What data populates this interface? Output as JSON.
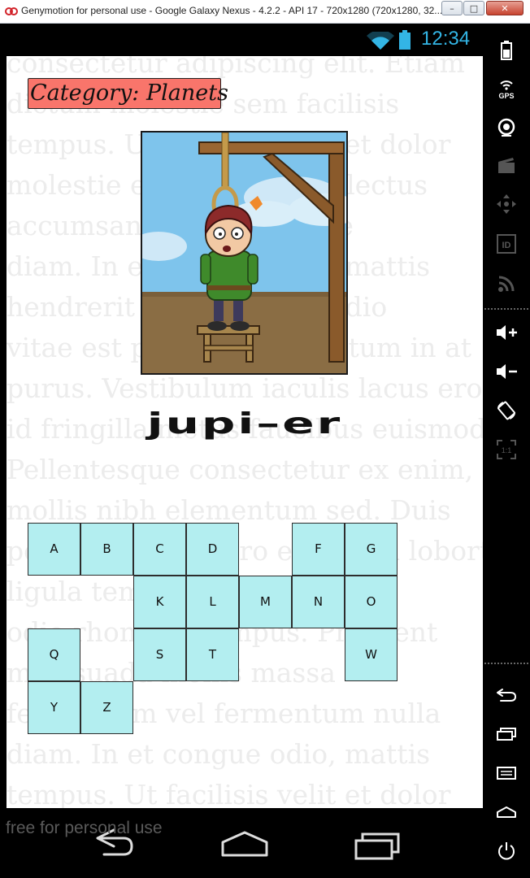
{
  "window": {
    "title": "Genymotion for personal use - Google Galaxy Nexus - 4.2.2 - API 17 - 720x1280 (720x1280, 32...",
    "minimize_label": "–",
    "maximize_label": "□",
    "close_label": "✕"
  },
  "statusbar": {
    "time": "12:34",
    "wifi_icon": "wifi-icon",
    "battery_icon": "battery-icon",
    "accent_color": "#33b5e5"
  },
  "game": {
    "category": "Category: Planets",
    "word": "jupi–er",
    "category_color": "#f9756b",
    "key_color": "#b3eef0",
    "keys": [
      {
        "letter": "A"
      },
      {
        "letter": "B"
      },
      {
        "letter": "C"
      },
      {
        "letter": "D"
      },
      {
        "letter": "F"
      },
      {
        "letter": "G"
      },
      {
        "letter": "K"
      },
      {
        "letter": "L"
      },
      {
        "letter": "M"
      },
      {
        "letter": "N"
      },
      {
        "letter": "O"
      },
      {
        "letter": "Q"
      },
      {
        "letter": "S"
      },
      {
        "letter": "T"
      },
      {
        "letter": "W"
      },
      {
        "letter": "Y"
      },
      {
        "letter": "Z"
      }
    ],
    "background_text": [
      "consectetur adipiscing elit. Etiam",
      "dictum molestie sem facilisis",
      "tempus. Ut facilisis velit et dolor",
      "molestie elementum sed lectus",
      "accumsan, ac scelerisque",
      "diam. In et congue odio, mattis",
      "hendrerit vulputate vel odio",
      "vitae est placerat fermentum in at",
      "purus. Vestibulum iaculis lacus eros,",
      "id fringilla metus faucibus euismod.",
      "Pellentesque consectetur ex enim, et",
      "mollis nibh elementum sed. Duis",
      "pellentesque libero erat, non lobortis",
      "ligula tempus ut. Duis vitae",
      "odio rhoncus, tempus. Praesent",
      "malesuada mollis massa",
      "fermentum vel fermentum nulla",
      "diam. In et congue odio, mattis",
      "tempus. Ut facilisis velit et dolor"
    ]
  },
  "navbar": {
    "back_icon": "back-icon",
    "home_icon": "home-icon",
    "recents_icon": "recent-apps-icon",
    "watermark": "free for personal use"
  },
  "sidebar": {
    "items": [
      {
        "icon": "battery-icon"
      },
      {
        "icon": "gps-icon",
        "label": "GPS"
      },
      {
        "icon": "camera-icon"
      },
      {
        "icon": "video-capture-icon"
      },
      {
        "icon": "dpad-icon"
      },
      {
        "icon": "id-icon",
        "label": "ID"
      },
      {
        "icon": "rss-icon"
      },
      {
        "icon": "volume-up-icon"
      },
      {
        "icon": "volume-down-icon"
      },
      {
        "icon": "rotate-icon"
      },
      {
        "icon": "pixel-perfect-icon",
        "label": "1:1"
      },
      {
        "icon": "back-icon"
      },
      {
        "icon": "recent-apps-icon"
      },
      {
        "icon": "menu-icon"
      },
      {
        "icon": "home-icon"
      },
      {
        "icon": "power-icon"
      }
    ]
  }
}
